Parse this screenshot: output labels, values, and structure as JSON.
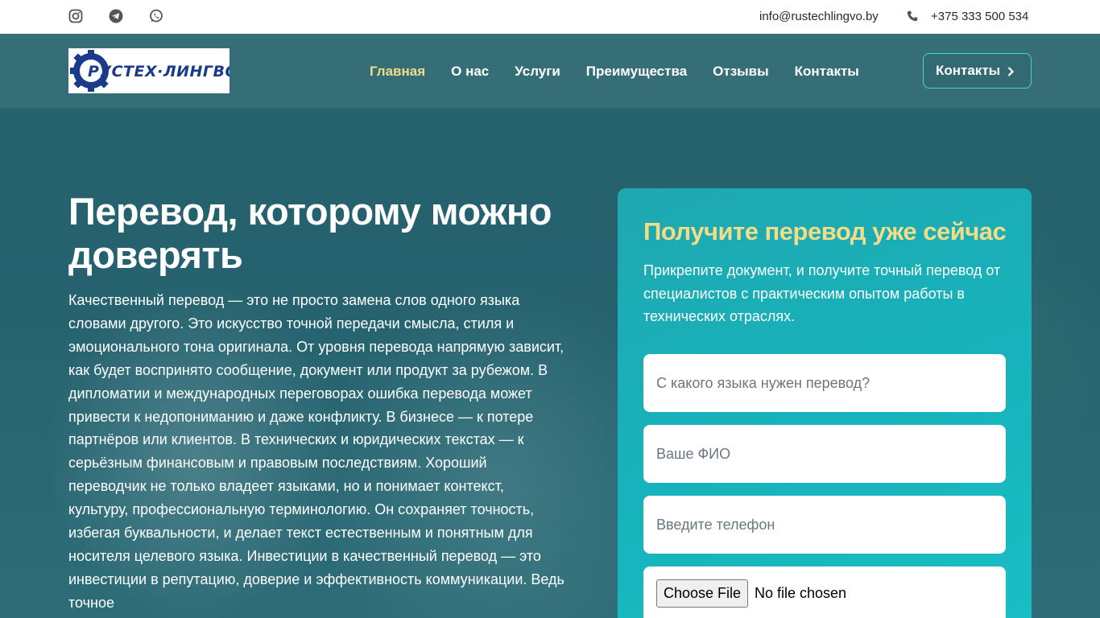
{
  "topbar": {
    "email": "info@rustechlingvo.by",
    "phone": "+375 333 500 534",
    "social": [
      "instagram-icon",
      "telegram-icon",
      "whatsapp-icon"
    ]
  },
  "logo": {
    "text": "РУСТЕХ·ЛИНГВО"
  },
  "nav": {
    "items": [
      {
        "label": "Главная",
        "active": true
      },
      {
        "label": "О нас"
      },
      {
        "label": "Услуги"
      },
      {
        "label": "Преимущества"
      },
      {
        "label": "Отзывы"
      },
      {
        "label": "Контакты"
      }
    ],
    "button_label": "Контакты"
  },
  "hero": {
    "title": "Перевод, которому можно доверять",
    "body": "Качественный перевод — это не просто замена слов одного языка словами другого. Это искусство точной передачи смысла, стиля и эмоционального тона оригинала. От уровня перевода напрямую зависит, как будет воспринято сообщение, документ или продукт за рубежом. В дипломатии и международных переговорах ошибка перевода может привести к недопониманию и даже конфликту. В бизнесе — к потере партнёров или клиентов. В технических и юридических текстах — к серьёзным финансовым и правовым последствиям. Хороший переводчик не только владеет языками, но и понимает контекст, культуру, профессиональную терминологию. Он сохраняет точность, избегая буквальности, и делает текст естественным и понятным для носителя целевого языка. Инвестиции в качественный перевод — это инвестиции в репутацию, доверие и эффективность коммуникации. Ведь точное"
  },
  "form": {
    "title": "Получите перевод уже сейчас",
    "description": "Прикрепите документ, и получите точный перевод от специалистов с практическим опытом работы в технических отраслях.",
    "language_placeholder": "С какого языка нужен перевод?",
    "name_placeholder": "Ваше ФИО",
    "phone_placeholder": "Введите телефон",
    "file_button": "Choose File",
    "file_status": "No file chosen"
  },
  "colors": {
    "accent": "#f3dc87",
    "card": "#17b2bb",
    "button_border": "#40d6d8"
  }
}
